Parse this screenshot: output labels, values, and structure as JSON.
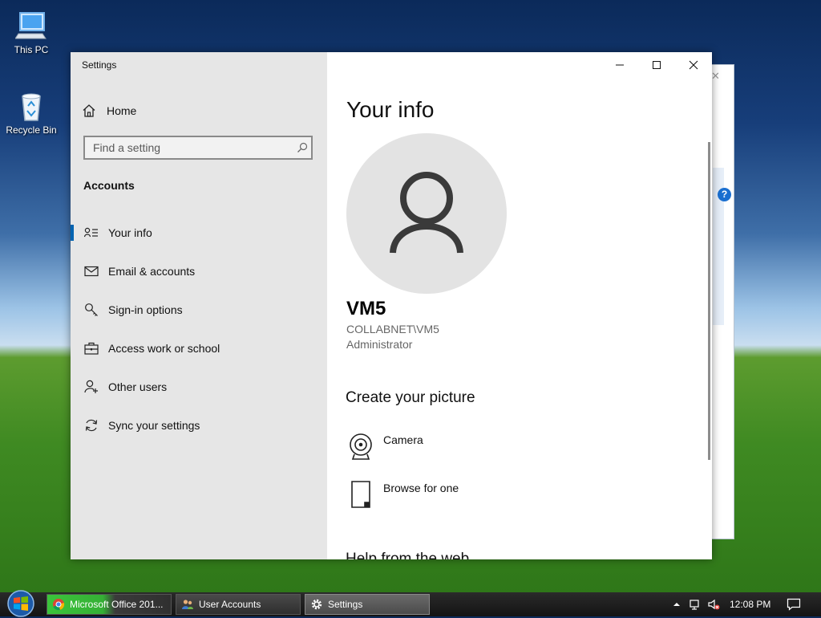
{
  "desktop": {
    "icons": [
      {
        "label": "This PC"
      },
      {
        "label": "Recycle Bin"
      }
    ]
  },
  "window": {
    "title": "Settings",
    "buttons": {
      "minimize": "minimize",
      "maximize": "maximize",
      "close": "close"
    }
  },
  "sidebar": {
    "home_label": "Home",
    "search_placeholder": "Find a setting",
    "section": "Accounts",
    "items": [
      {
        "label": "Your info",
        "icon": "person-card-icon",
        "active": true
      },
      {
        "label": "Email & accounts",
        "icon": "mail-icon"
      },
      {
        "label": "Sign-in options",
        "icon": "key-icon"
      },
      {
        "label": "Access work or school",
        "icon": "briefcase-icon"
      },
      {
        "label": "Other users",
        "icon": "person-add-icon"
      },
      {
        "label": "Sync your settings",
        "icon": "sync-icon"
      }
    ]
  },
  "main": {
    "title": "Your info",
    "user": {
      "name": "VM5",
      "account": "COLLABNET\\VM5",
      "role": "Administrator"
    },
    "create_picture": {
      "heading": "Create your picture",
      "options": [
        {
          "label": "Camera",
          "icon": "camera-icon"
        },
        {
          "label": "Browse for one",
          "icon": "browse-icon"
        }
      ]
    },
    "cut_heading": "Help from the web"
  },
  "taskbar": {
    "buttons": [
      {
        "label": "Microsoft Office 201...",
        "icon": "chrome-icon"
      },
      {
        "label": "User Accounts",
        "icon": "users-icon"
      },
      {
        "label": "Settings",
        "icon": "gear-icon"
      }
    ],
    "clock": "12:08 PM"
  },
  "colors": {
    "accent": "#0063b1",
    "sidebar_bg": "#e6e6e6",
    "avatar_bg": "#e3e3e3"
  }
}
